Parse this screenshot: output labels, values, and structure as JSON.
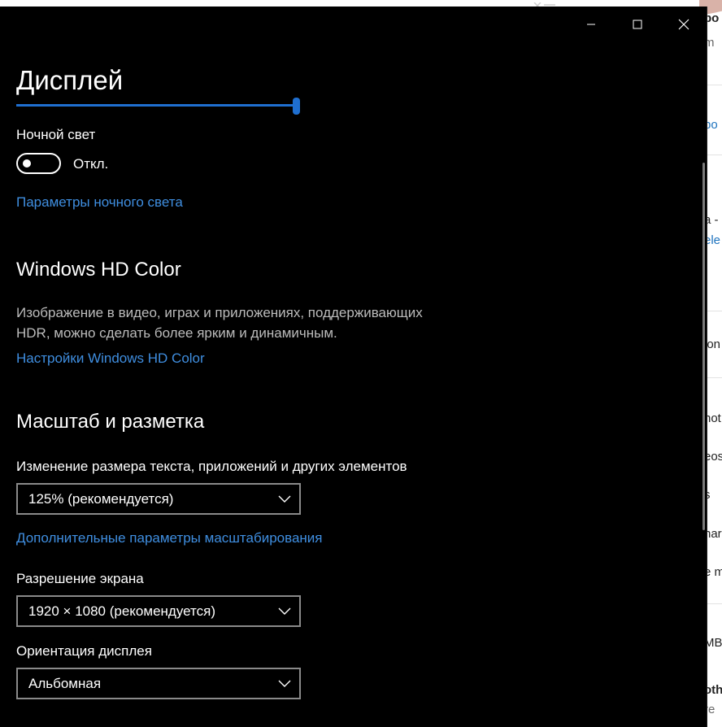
{
  "window": {
    "minimize_label": "Minimize",
    "maximize_label": "Maximize",
    "close_label": "Close"
  },
  "page": {
    "title": "Дисплей"
  },
  "night_light": {
    "label": "Ночной свет",
    "state": "Откл.",
    "settings_link": "Параметры ночного света"
  },
  "hd_color": {
    "heading": "Windows HD Color",
    "description": "Изображение в видео, играх и приложениях, поддерживающих HDR, можно сделать более ярким и динамичным.",
    "settings_link": "Настройки Windows HD Color"
  },
  "scale_layout": {
    "heading": "Масштаб и разметка",
    "scale_label": "Изменение размера текста, приложений и других элементов",
    "scale_value": "125% (рекомендуется)",
    "advanced_link": "Дополнительные параметры масштабирования",
    "resolution_label": "Разрешение экрана",
    "resolution_value": "1920 × 1080 (рекомендуется)",
    "orientation_label": "Ориентация дисплея",
    "orientation_value": "Альбомная"
  },
  "background_window": {
    "fragments": [
      "bo",
      "m",
      "bo",
      "a -",
      "ele",
      "ion",
      "hot",
      "eos",
      "s",
      "har",
      "e m",
      "MB",
      "oth",
      "re"
    ]
  },
  "colors": {
    "background": "#000000",
    "accent": "#1f6fd0",
    "link": "#3f8ee0",
    "text": "#ffffff",
    "secondary_text": "#bcbcbc",
    "control_border": "#8a8a8a"
  }
}
